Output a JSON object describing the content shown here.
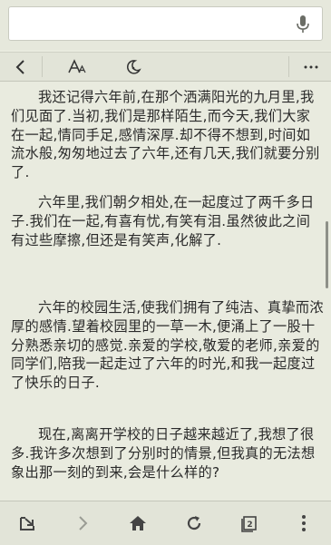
{
  "search": {
    "value": "",
    "placeholder": ""
  },
  "toolbar": {
    "back_icon": "chevron-left-icon",
    "font_icon": "font-size-icon",
    "night_icon": "night-mode-icon",
    "more_icon": "more-horizontal-icon"
  },
  "article": {
    "paragraphs": [
      "我还记得六年前,在那个洒满阳光的九月里,我们见面了.当初,我们是那样陌生,而今天,我们大家在一起,情同手足,感情深厚.却不得不想到,时间如流水般,匆匆地过去了六年,还有几天,我们就要分别了.",
      "六年里,我们朝夕相处,在一起度过了两千多日子.我们在一起,有喜有忧,有笑有泪.虽然彼此之间有过些摩擦,但还是有笑声,化解了.",
      "六年的校园生活,使我们拥有了纯洁、真挚而浓厚的感情.望着校园里的一草一木,便涌上了一股十分熟悉亲切的感觉.亲爱的学校,敬爱的老师,亲爱的同学们,陪我一起走过了六年的时光,和我一起度过了快乐的日子.",
      "现在,离离开学校的日子越来越近了,我想了很多.我许多次想到了分别时的情景,但我真的无法想象出那一刻的到来,会是什么样的?"
    ]
  },
  "bottombar": {
    "icons": [
      "exit-icon",
      "forward-icon",
      "home-icon",
      "refresh-icon",
      "tabs-icon",
      "menu-icon"
    ],
    "tab_count": "2"
  },
  "colors": {
    "background": "#e9ebdf",
    "text": "#2a2a2a",
    "icon": "#444444",
    "disabled": "#9a9c94"
  }
}
